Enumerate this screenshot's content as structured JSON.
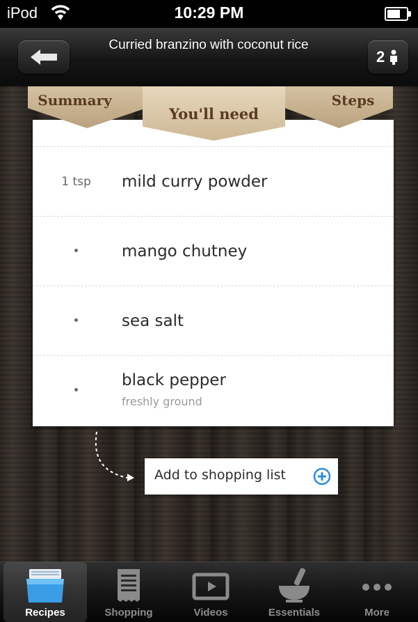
{
  "status_bar": {
    "carrier": "iPod",
    "time": "10:29 PM"
  },
  "nav": {
    "title": "Curried branzino with coconut rice",
    "servings": "2"
  },
  "tabs": [
    {
      "label": "Summary",
      "selected": false
    },
    {
      "label": "You'll need",
      "selected": true
    },
    {
      "label": "Steps",
      "selected": false
    }
  ],
  "ingredients": [
    {
      "qty": "1 tsp",
      "name": "mild curry powder",
      "note": ""
    },
    {
      "qty": "•",
      "name": "mango chutney",
      "note": ""
    },
    {
      "qty": "•",
      "name": "sea salt",
      "note": ""
    },
    {
      "qty": "•",
      "name": "black pepper",
      "note": "freshly ground"
    }
  ],
  "shopping": {
    "add_label": "Add to shopping list"
  },
  "tabbar": [
    {
      "label": "Recipes",
      "icon": "recipes-icon",
      "active": true
    },
    {
      "label": "Shopping",
      "icon": "shopping-list-icon",
      "active": false
    },
    {
      "label": "Videos",
      "icon": "video-icon",
      "active": false
    },
    {
      "label": "Essentials",
      "icon": "mortar-pestle-icon",
      "active": false
    },
    {
      "label": "More",
      "icon": "more-icon",
      "active": false
    }
  ],
  "colors": {
    "accent_blue": "#2a8fd8",
    "tab_paper": "#d5c2a2",
    "tab_text": "#5a3a22"
  }
}
